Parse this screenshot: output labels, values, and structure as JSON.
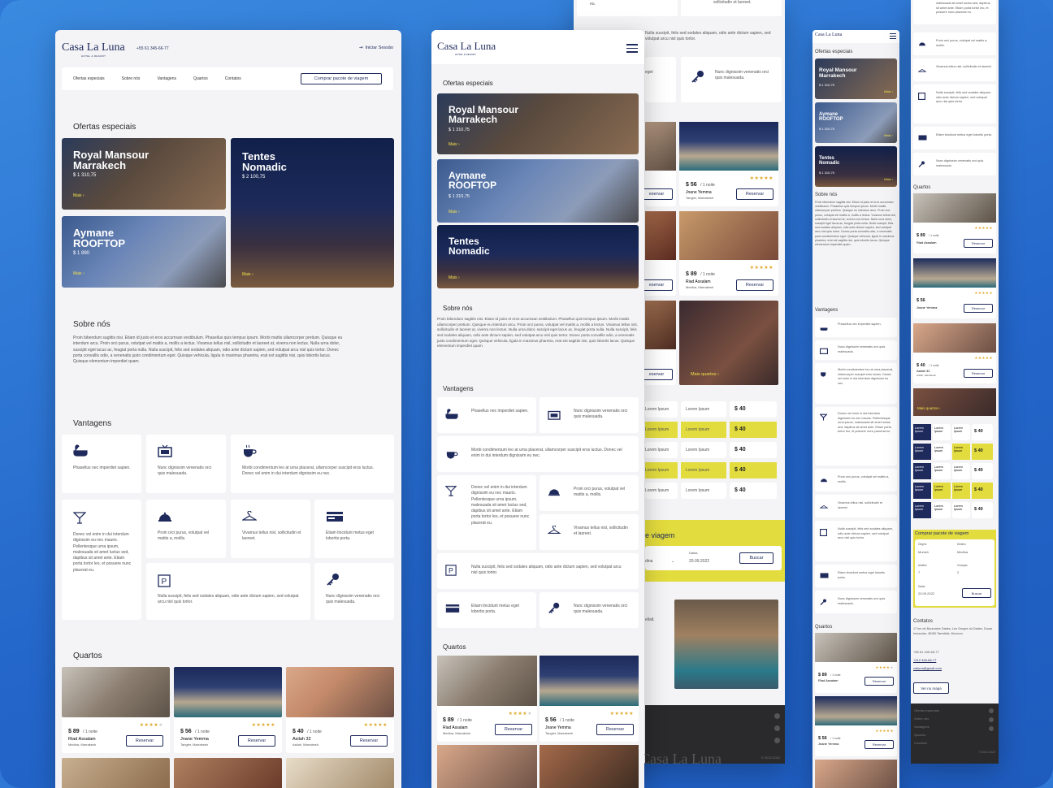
{
  "brand": {
    "logo": "Casa La Luna",
    "tagline": "HOTEL & RESORT",
    "phone": "+55 61 345-66-77",
    "login": "Iniciar Sessão"
  },
  "nav": {
    "items": [
      "Ofertas especiais",
      "Sobre nós",
      "Vantagens",
      "Quartos",
      "Contatos"
    ],
    "cta": "Comprar pacote de viagem"
  },
  "sections": {
    "offers": "Ofertas especiais",
    "about": "Sobre nós",
    "advantages": "Vantagens",
    "rooms": "Quartos",
    "contacts": "Contatos"
  },
  "offers": [
    {
      "title1": "Royal Mansour",
      "title2": "Marrakech",
      "price": "$ 1 310,75",
      "more": "Mais"
    },
    {
      "title1": "Aymane",
      "title2": "ROOFTOP",
      "price": "$ 1 890",
      "more": "Mais"
    },
    {
      "title1": "Tentes",
      "title2": "Nomadic",
      "price": "$ 2 100,75",
      "more": "Mais"
    }
  ],
  "about_text": "Proin bibendum sagittis nisi. Etiam id justo et eros accumsan vestibulum. Phasellus quis tempus ipsum. Morbi mattis ullamcorper pretium. Quisque eu interdum arcu. Proin orci purus, volutpat vel mattis a, mollis a lectus. Vivamus tellus nisl, sollicitudin et laoreet at, viverra non lectus. Nulla urna dolor, suscipit eget lacus ac, feugiat porta nulla. Nulla suscipit, felis sed sodales aliquam, odio ante dictum sapien, sed volutpat arcu nisl quis tortor. Donec porta convallis odio, a venenatis justo condimentum eget. Quisque vehicula, ligula in maximus pharetra, erat est sagittis nisi, quis lobortis lacus. Quisque elementum imperdiet quam.",
  "advantages": [
    {
      "icon": "bathtub-icon",
      "text": "Phasellus nec imperdiet sapien."
    },
    {
      "icon": "tv-icon",
      "text": "Nunc dignissim venenatis orci quis malesuada."
    },
    {
      "icon": "coffee-cup-icon",
      "text": "Morbi condimentum leo at urna placerat, ullamcorper suscipit eros luctus. Donec vel enim in dui interdum dignissim eu nec."
    },
    {
      "icon": "cocktail-icon",
      "text": "Donec vel enim in dui interdum dignissim eu nec mauris. Pellentesque urna ipsum, malesuada sit amet luctus sed, dapibus sit amet ante. Etiam porta tortor leo, et posuere nunc placerat eu."
    },
    {
      "icon": "cloche-icon",
      "text": "Proin orci purus, volutpat vel mattis a, mollis."
    },
    {
      "icon": "hanger-icon",
      "text": "Vivamus tellus nisl, sollicitudin et laoreet."
    },
    {
      "icon": "card-icon",
      "text": "Etiam tincidunt metus eget lobortis porta."
    },
    {
      "icon": "parking-icon",
      "text": "Nulla suscipit, felis sed sodales aliquam, odio ante dictum sapien, sed volutpat arcu nisl quis tortor."
    },
    {
      "icon": "key-icon",
      "text": "Nunc dignissim venenatis orci quis malesuada."
    }
  ],
  "rooms": [
    {
      "price": "$ 89",
      "per": "/ 1 noite",
      "name": "Riad Assalam",
      "location": "Medina, Marrakesh",
      "button": "Reservar"
    },
    {
      "price": "$ 56",
      "per": "/ 1 noite",
      "name": "Jnane Yemma",
      "location": "Tangier, Marrakesh",
      "button": "Reservar"
    },
    {
      "price": "$ 40",
      "per": "/ 1 noite",
      "name": "Asilah 32",
      "location": "Asilah, Marrakesh",
      "button": "Reservar"
    }
  ],
  "more_rooms": "Mais quartos",
  "table": {
    "cell": "Lorem Ipsum",
    "price": "$ 40"
  },
  "booking": {
    "title": "Comprar pacote de viagem",
    "origin_label": "Origem",
    "origin": "Munich",
    "dest_label": "Destino",
    "dest": "Medina",
    "adults_label": "Adultos",
    "adults": "7",
    "children_label": "Crianças",
    "children": "2",
    "dates_label": "Datas",
    "date": "20.09.2022",
    "search": "Buscar",
    "partial_title": "e viagem",
    "partial_dest": "dina"
  },
  "contacts": {
    "address": "17 km de Boumalne Dades, Les Gorges du Dades, Douar Imzoudar, 45150 Tamellalt, Morocco",
    "phone1": "+55 61 345-66-77",
    "phone2": "+212 345-66-77",
    "email": "cialuna@gmail.com",
    "map": "Ver no mapa"
  },
  "footer": {
    "links": [
      "Ofertas especiais",
      "Sobre nós",
      "Vantagens",
      "Quartos",
      "Contatos"
    ],
    "copy": "© 2012-2022"
  },
  "colors": {
    "navy": "#1f2a5c",
    "yellow": "#e3dc3e",
    "bg_blue": "#2f78d6"
  }
}
